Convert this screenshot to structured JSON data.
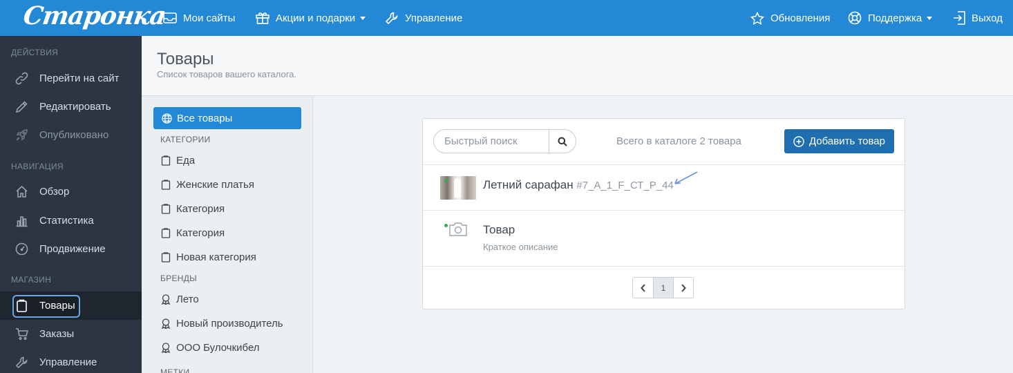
{
  "header": {
    "logo": "Старонка",
    "nav_left": [
      {
        "label": "Мои сайты",
        "icon": "sites-icon"
      },
      {
        "label": "Акции и подарки",
        "icon": "gift-icon"
      },
      {
        "label": "Управление",
        "icon": "wrench-icon"
      }
    ],
    "nav_right": [
      {
        "label": "Обновления",
        "icon": "star-icon"
      },
      {
        "label": "Поддержка",
        "icon": "lifebuoy-icon"
      },
      {
        "label": "Выход",
        "icon": "logout-icon"
      }
    ]
  },
  "sidebar": {
    "sections": [
      "Действия",
      "Навигация",
      "Магазин"
    ],
    "actions": [
      {
        "label": "Перейти на сайт",
        "icon": "link-icon"
      },
      {
        "label": "Редактировать",
        "icon": "pencil-icon"
      },
      {
        "label": "Опубликовано",
        "icon": "rocket-icon"
      }
    ],
    "navigation": [
      {
        "label": "Обзор",
        "icon": "home-icon"
      },
      {
        "label": "Статистика",
        "icon": "chart-icon"
      },
      {
        "label": "Продвижение",
        "icon": "gauge-icon"
      }
    ],
    "shop": [
      {
        "label": "Товары",
        "icon": "clipboard-icon",
        "active": true
      },
      {
        "label": "Заказы",
        "icon": "cart-icon"
      },
      {
        "label": "Управление",
        "icon": "wrench-icon"
      }
    ]
  },
  "page": {
    "title": "Товары",
    "subtitle": "Список товаров вашего каталога."
  },
  "categories": {
    "all_label": "Все товары",
    "categories_heading": "Категории",
    "items": [
      "Еда",
      "Женские платья",
      "Категория",
      "Категория",
      "Новая категория"
    ],
    "brands_heading": "Бренды",
    "brands": [
      "Лето",
      "Новый производитель",
      "ООО Булочкибел"
    ],
    "tags_heading": "Метки"
  },
  "catalog": {
    "search_placeholder": "Быстрый поиск",
    "total_text": "Всего в каталоге 2 товара",
    "add_label": "Добавить товар",
    "products": [
      {
        "name": "Летний сарафан",
        "sku": "#7_А_1_F_СТ_Р_44",
        "description": "",
        "status_color": "#2ab24a"
      },
      {
        "name": "Товар",
        "sku": "",
        "description": "Краткое описание",
        "status_color": "#2ab24a"
      }
    ],
    "pagination": {
      "current": "1"
    }
  },
  "colors": {
    "accent": "#2389d7",
    "sidebar_bg": "#2b3642",
    "add_button": "#1f6fb0"
  }
}
